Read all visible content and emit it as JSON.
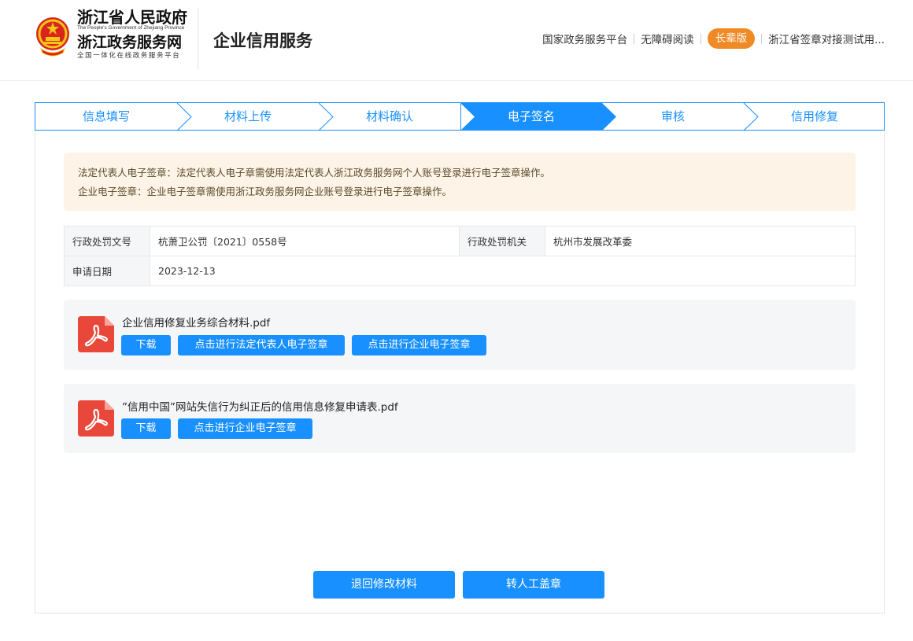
{
  "header": {
    "gov_name": "浙江省人民政府",
    "gov_name_en": "The People's Government of Zhejiang Province",
    "service_name": "浙江政务服务网",
    "service_tagline": "全国一体化在线政务服务平台",
    "page_title": "企业信用服务",
    "nav": {
      "national_platform": "国家政务服务平台",
      "accessibility": "无障碍阅读",
      "elder_mode": "长辈版",
      "user": "浙江省签章对接测试用..."
    }
  },
  "steps": [
    {
      "label": "信息填写"
    },
    {
      "label": "材料上传"
    },
    {
      "label": "材料确认"
    },
    {
      "label": "电子签名"
    },
    {
      "label": "审核"
    },
    {
      "label": "信用修复"
    }
  ],
  "notice": {
    "line1": "法定代表人电子签章：法定代表人电子章需使用法定代表人浙江政务服务网个人账号登录进行电子签章操作。",
    "line2": "企业电子签章：企业电子签章需使用浙江政务服务网企业账号登录进行电子签章操作。"
  },
  "info": {
    "doc_no_label": "行政处罚文号",
    "doc_no_value": "杭萧卫公罚〔2021〕0558号",
    "authority_label": "行政处罚机关",
    "authority_value": "杭州市发展改革委",
    "date_label": "申请日期",
    "date_value": "2023-12-13"
  },
  "files": [
    {
      "name": "企业信用修复业务综合材料.pdf",
      "download": "下载",
      "legal_sign": "点击进行法定代表人电子签章",
      "company_sign": "点击进行企业电子签章"
    },
    {
      "name": "”信用中国”网站失信行为纠正后的信用信息修复申请表.pdf",
      "download": "下载",
      "company_sign": "点击进行企业电子签章"
    }
  ],
  "actions": {
    "back": "退回修改材料",
    "manual": "转人工盖章"
  },
  "colors": {
    "primary": "#1890ff",
    "accent": "#f08a24",
    "notice_bg": "#fdf3e6",
    "pdf_red": "#e8473a"
  }
}
